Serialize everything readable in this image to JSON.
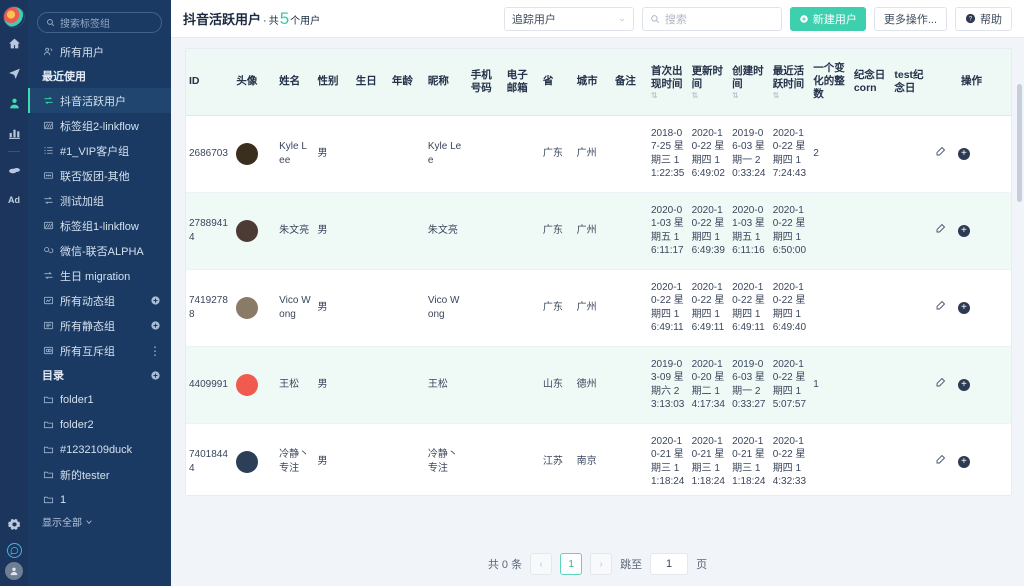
{
  "rail": {
    "logo_name": "app-logo",
    "items": [
      {
        "name": "home-icon",
        "label": "首页"
      },
      {
        "name": "send-icon",
        "label": "营销"
      },
      {
        "name": "user-icon",
        "label": "用户",
        "active": true
      },
      {
        "name": "chart-bar-icon",
        "label": "分析"
      },
      {
        "name": "cookie-icon",
        "label": "数据"
      },
      {
        "name": "ad-text-icon",
        "label": "Ad"
      }
    ],
    "bottom": [
      {
        "name": "gear-icon",
        "label": "设置"
      },
      {
        "name": "chat-icon",
        "label": "消息"
      },
      {
        "name": "avatar-icon",
        "label": "账号"
      }
    ]
  },
  "sidebar": {
    "search_placeholder": "搜索标签组",
    "all_users": "所有用户",
    "recent_label": "最近使用",
    "recent_items": [
      {
        "label": "抖音活跃用户",
        "icon": "sync-icon",
        "active": true
      },
      {
        "label": "标签组2-linkflow",
        "icon": "tag-icon",
        "active": false
      },
      {
        "label": "#1_VIP客户组",
        "icon": "list-icon",
        "active": false
      },
      {
        "label": "联否饭团-其他",
        "icon": "dots-box-icon",
        "active": false
      },
      {
        "label": "测试加组",
        "icon": "sync-icon",
        "active": false
      },
      {
        "label": "标签组1-linkflow",
        "icon": "tag-icon",
        "active": false
      },
      {
        "label": "微信-联否ALPHA",
        "icon": "link-icon",
        "active": false
      },
      {
        "label": "生日 migration",
        "icon": "sync-icon",
        "active": false
      }
    ],
    "groups": [
      {
        "label": "所有动态组",
        "icon": "dynamic-group-icon",
        "action": "plus"
      },
      {
        "label": "所有静态组",
        "icon": "static-group-icon",
        "action": "plus"
      },
      {
        "label": "所有互斥组",
        "icon": "exclusive-group-icon",
        "action": "more"
      }
    ],
    "catalog_label": "目录",
    "catalog_action": "plus",
    "folders": [
      {
        "label": "folder1"
      },
      {
        "label": "folder2"
      },
      {
        "label": "#1232109duck"
      },
      {
        "label": "新的tester"
      },
      {
        "label": "1"
      }
    ],
    "show_all": "显示全部"
  },
  "topbar": {
    "title": "抖音活跃用户",
    "separator": "·",
    "count_prefix": "共",
    "count": "5",
    "count_suffix": "个用户",
    "filter_value": "追踪用户",
    "search_placeholder": "搜索",
    "create_label": "新建用户",
    "more_label": "更多操作...",
    "help_label": "帮助",
    "accent": "#3ecfae"
  },
  "table": {
    "columns": [
      {
        "label": "ID",
        "sortable": false
      },
      {
        "label": "头像",
        "sortable": false
      },
      {
        "label": "姓名",
        "sortable": false
      },
      {
        "label": "性别",
        "sortable": false
      },
      {
        "label": "生日",
        "sortable": false
      },
      {
        "label": "年龄",
        "sortable": false
      },
      {
        "label": "昵称",
        "sortable": false
      },
      {
        "label": "手机号码",
        "sortable": false
      },
      {
        "label": "电子邮箱",
        "sortable": false
      },
      {
        "label": "省",
        "sortable": false
      },
      {
        "label": "城市",
        "sortable": false
      },
      {
        "label": "备注",
        "sortable": false
      },
      {
        "label": "首次出现时间",
        "sortable": true
      },
      {
        "label": "更新时间",
        "sortable": true
      },
      {
        "label": "创建时间",
        "sortable": true
      },
      {
        "label": "最近活跃时间",
        "sortable": true
      },
      {
        "label": "一个变化的整数",
        "sortable": false
      },
      {
        "label": "纪念日corn",
        "sortable": false
      },
      {
        "label": "test纪念日",
        "sortable": false
      },
      {
        "label": "操作",
        "sortable": false
      }
    ],
    "rows": [
      {
        "id": "2686703",
        "avatar": "#3a2f1e",
        "name": "Kyle Lee",
        "gender": "男",
        "birthday": "",
        "age": "",
        "nickname": "Kyle Lee",
        "phone": "",
        "email": "",
        "province": "广东",
        "city": "广州",
        "note": "",
        "first_seen": "2018-07-25 星期三 11:22:35",
        "updated": "2020-10-22 星期四 16:49:02",
        "created": "2019-06-03 星期一 20:33:24",
        "last_active": "2020-10-22 星期四 17:24:43",
        "changing_int": "2",
        "anniversary_corn": "",
        "test_anniversary": ""
      },
      {
        "id": "27889414",
        "avatar": "#4b3b34",
        "name": "朱文亮",
        "gender": "男",
        "birthday": "",
        "age": "",
        "nickname": "朱文亮",
        "phone": "",
        "email": "",
        "province": "广东",
        "city": "广州",
        "note": "",
        "first_seen": "2020-01-03 星期五 16:11:17",
        "updated": "2020-10-22 星期四 16:49:39",
        "created": "2020-01-03 星期五 16:11:16",
        "last_active": "2020-10-22 星期四 16:50:00",
        "changing_int": "",
        "anniversary_corn": "",
        "test_anniversary": ""
      },
      {
        "id": "74192788",
        "avatar": "#8a7a68",
        "name": "Vico Wong",
        "gender": "男",
        "birthday": "",
        "age": "",
        "nickname": "Vico Wong",
        "phone": "",
        "email": "",
        "province": "广东",
        "city": "广州",
        "note": "",
        "first_seen": "2020-10-22 星期四 16:49:11",
        "updated": "2020-10-22 星期四 16:49:11",
        "created": "2020-10-22 星期四 16:49:11",
        "last_active": "2020-10-22 星期四 16:49:40",
        "changing_int": "",
        "anniversary_corn": "",
        "test_anniversary": ""
      },
      {
        "id": "4409991",
        "avatar": "#f05a4f",
        "name": "王松",
        "gender": "男",
        "birthday": "",
        "age": "",
        "nickname": "王松",
        "phone": "",
        "email": "",
        "province": "山东",
        "city": "德州",
        "note": "",
        "first_seen": "2019-03-09 星期六 23:13:03",
        "updated": "2020-10-20 星期二 14:17:34",
        "created": "2019-06-03 星期一 20:33:27",
        "last_active": "2020-10-22 星期四 15:07:57",
        "changing_int": "1",
        "anniversary_corn": "",
        "test_anniversary": ""
      },
      {
        "id": "74018444",
        "avatar": "#2c3f57",
        "name": "冷静丶专注",
        "gender": "男",
        "birthday": "",
        "age": "",
        "nickname": "冷静丶专注",
        "phone": "",
        "email": "",
        "province": "江苏",
        "city": "南京",
        "note": "",
        "first_seen": "2020-10-21 星期三 11:18:24",
        "updated": "2020-10-21 星期三 11:18:24",
        "created": "2020-10-21 星期三 11:18:24",
        "last_active": "2020-10-22 星期四 14:32:33",
        "changing_int": "",
        "anniversary_corn": "",
        "test_anniversary": ""
      }
    ],
    "row_actions": {
      "edit": "edit-icon",
      "add": "add-icon"
    }
  },
  "pagination": {
    "total_text": "共 0 条",
    "prev": "‹",
    "next": "›",
    "current_page": "1",
    "jump_label": "跳至",
    "jump_value": "1",
    "page_unit": "页"
  }
}
